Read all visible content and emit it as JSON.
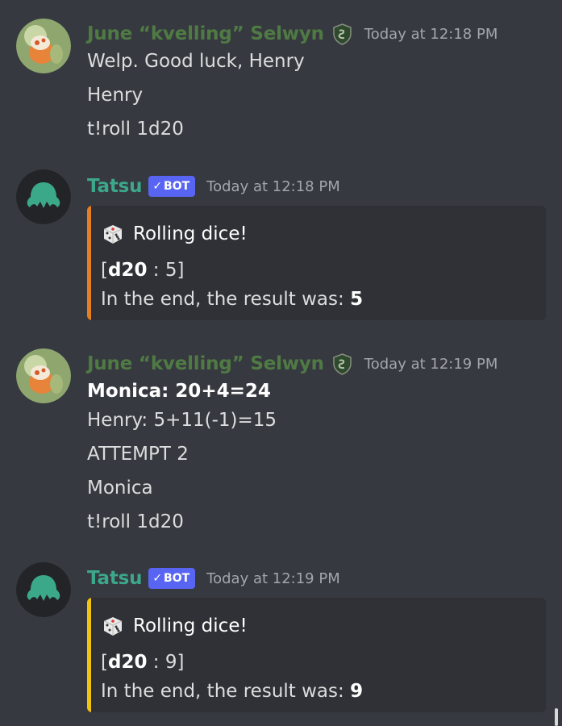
{
  "messages": [
    {
      "author": "June “kvelling” Selwyn",
      "timestamp": "Today at 12:18 PM",
      "lines": [
        "Welp. Good luck, Henry",
        "Henry",
        "t!roll 1d20"
      ]
    },
    {
      "author": "Tatsu",
      "bot_tag": "BOT",
      "timestamp": "Today at 12:18 PM",
      "embed": {
        "accent_color": "#e67e22",
        "title": "Rolling dice!",
        "die_label": "d20",
        "die_separator": " : ",
        "die_result": "5",
        "result_prefix": "In the end, the result was: ",
        "result_value": "5"
      }
    },
    {
      "author": "June “kvelling” Selwyn",
      "timestamp": "Today at 12:19 PM",
      "bold_line": "Monica: 20+4=24",
      "lines": [
        "Henry: 5+11(-1)=15",
        "ATTEMPT 2",
        "Monica",
        "t!roll 1d20"
      ]
    },
    {
      "author": "Tatsu",
      "bot_tag": "BOT",
      "timestamp": "Today at 12:19 PM",
      "embed": {
        "accent_color": "#f1c40f",
        "title": "Rolling dice!",
        "die_label": "d20",
        "die_separator": " : ",
        "die_result": "9",
        "result_prefix": "In the end, the result was: ",
        "result_value": "9"
      }
    }
  ],
  "icons": {
    "role_icon": "slytherin-crest-icon",
    "embed_icon": "dice-icon",
    "bot_check": "checkmark-icon"
  },
  "colors": {
    "background": "#36393f",
    "embed_background": "#2f3136",
    "june_name": "#4f7a44",
    "tatsu_name": "#3ba88a",
    "bot_tag": "#5865f2"
  }
}
